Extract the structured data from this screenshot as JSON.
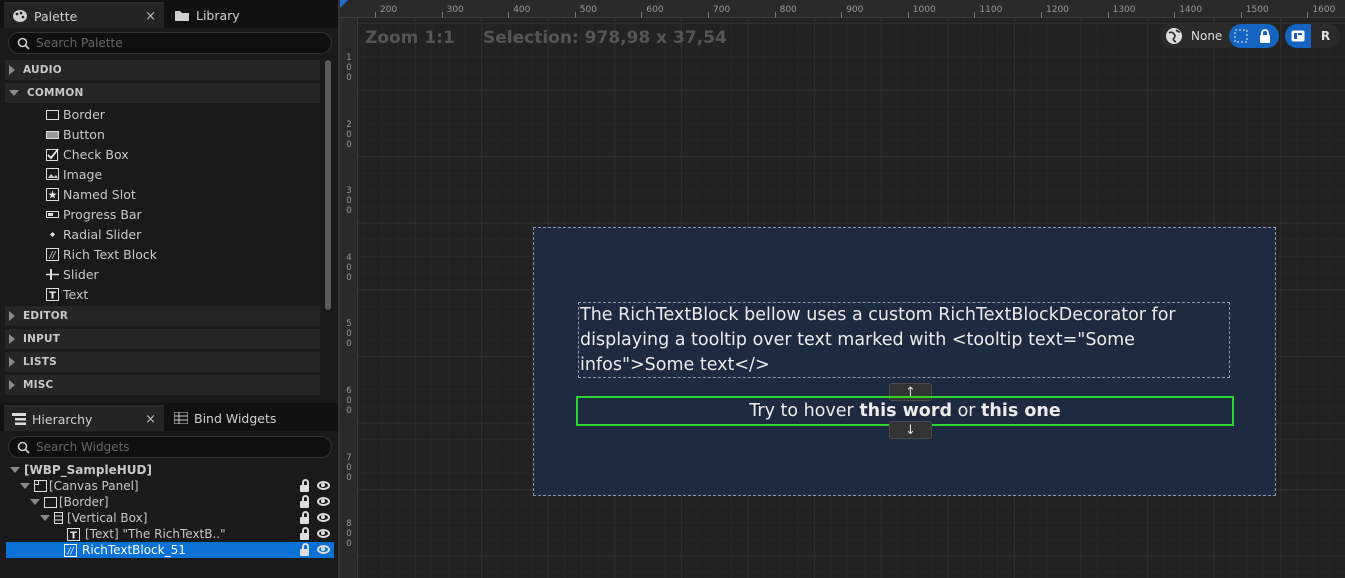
{
  "palette": {
    "tab_palette": "Palette",
    "tab_library": "Library",
    "close_glyph": "×",
    "search_placeholder": "Search Palette",
    "categories": {
      "audio": "AUDIO",
      "common": "COMMON",
      "editor": "EDITOR",
      "input": "INPUT",
      "lists": "LISTS",
      "misc": "MISC"
    },
    "common_items": [
      "Border",
      "Button",
      "Check Box",
      "Image",
      "Named Slot",
      "Progress Bar",
      "Radial Slider",
      "Rich Text Block",
      "Slider",
      "Text"
    ]
  },
  "hierarchy": {
    "tab_hierarchy": "Hierarchy",
    "tab_bind": "Bind Widgets",
    "close_glyph": "×",
    "search_placeholder": "Search Widgets",
    "rows": [
      "[WBP_SampleHUD]",
      "[Canvas Panel]",
      "[Border]",
      "[Vertical Box]",
      "[Text] \"The RichTextB..\"",
      "RichTextBlock_51"
    ]
  },
  "viewport": {
    "zoom_label": "Zoom 1:1",
    "selection_label": "Selection: 978,98 x 37,54",
    "ruler_top": [
      "200",
      "300",
      "400",
      "500",
      "600",
      "700",
      "800",
      "900",
      "1000",
      "1100",
      "1200",
      "1300",
      "1400",
      "1500",
      "1600"
    ],
    "ruler_left": [
      "100",
      "200",
      "300",
      "400",
      "500",
      "600",
      "700",
      "800"
    ],
    "toolbar": {
      "localization_label": "None",
      "r_label": "R"
    },
    "text_widget": "The RichTextBlock bellow uses a custom RichTextBlockDecorator for displaying a tooltip over text marked with <tooltip text=\"Some infos\">Some text</>",
    "rich_text": {
      "part1": "Try to hover ",
      "bold1": "this word",
      "part2": " or ",
      "bold2": "this one"
    },
    "arrow_up": "↑",
    "arrow_down": "↓"
  },
  "colors": {
    "selection": "#0a72d6",
    "selected_outline": "#2ad62a",
    "canvas_bg": "#1d2a3f",
    "toolbar_active": "#1565c0"
  }
}
